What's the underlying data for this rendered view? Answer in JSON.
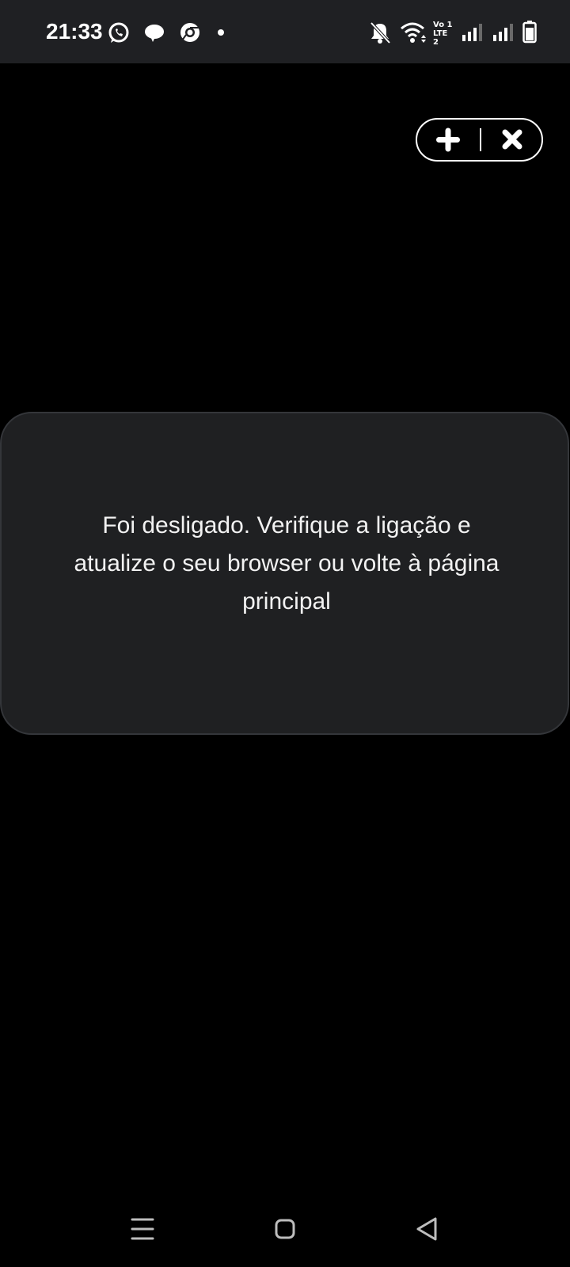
{
  "status_bar": {
    "time": "21:33",
    "left_icons": [
      "whatsapp-icon",
      "chat-bubble-icon",
      "chrome-icon",
      "notification-dot-icon"
    ],
    "right_icons": [
      "bell-off-icon",
      "wifi-icon",
      "volte-icon",
      "signal-icon",
      "signal-icon",
      "battery-icon"
    ],
    "volte_line1": "Vo 1",
    "volte_line2": "LTE 2"
  },
  "toolbar": {
    "add_icon": "plus-icon",
    "close_icon": "close-icon"
  },
  "message_card": {
    "text": "Foi desligado. Verifique a ligação e atualize o seu browser ou volte à página principal"
  },
  "nav_bar": {
    "icons": [
      "menu-icon",
      "home-icon",
      "back-icon"
    ]
  },
  "colors": {
    "background": "#000000",
    "status_bar": "#1f2023",
    "card": "#1f2022",
    "card_border": "#34363a",
    "text": "#ffffff",
    "nav_icon": "#bdbdbd"
  }
}
